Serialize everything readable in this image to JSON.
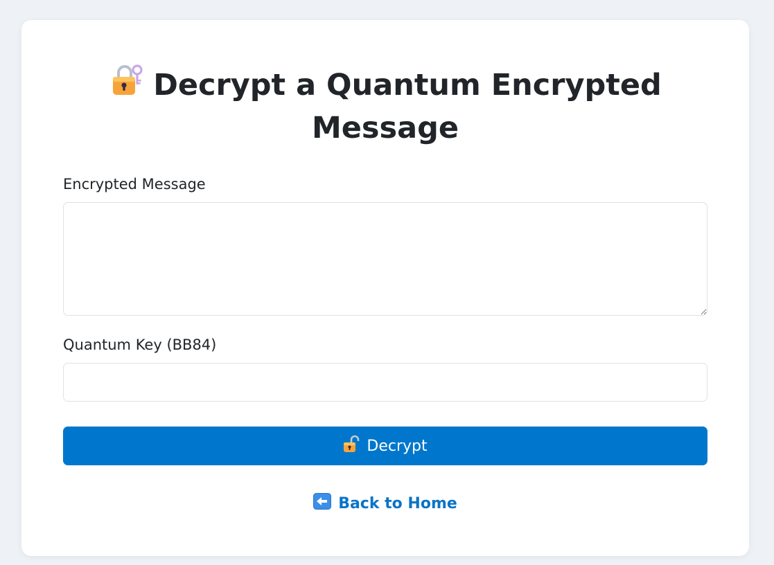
{
  "page": {
    "title": "Decrypt a Quantum Encrypted Message",
    "title_icon": "locked-with-key-icon"
  },
  "form": {
    "encrypted_message": {
      "label": "Encrypted Message",
      "value": "",
      "placeholder": ""
    },
    "quantum_key": {
      "label": "Quantum Key (BB84)",
      "value": "",
      "placeholder": ""
    },
    "submit": {
      "label": "Decrypt",
      "icon": "unlocked-padlock-icon"
    }
  },
  "navigation": {
    "back_label": "Back to Home",
    "back_icon": "left-arrow-icon"
  },
  "colors": {
    "background": "#eef2f7",
    "card": "#ffffff",
    "button": "#0077cc",
    "link": "#0a74c8",
    "text": "#212529"
  }
}
